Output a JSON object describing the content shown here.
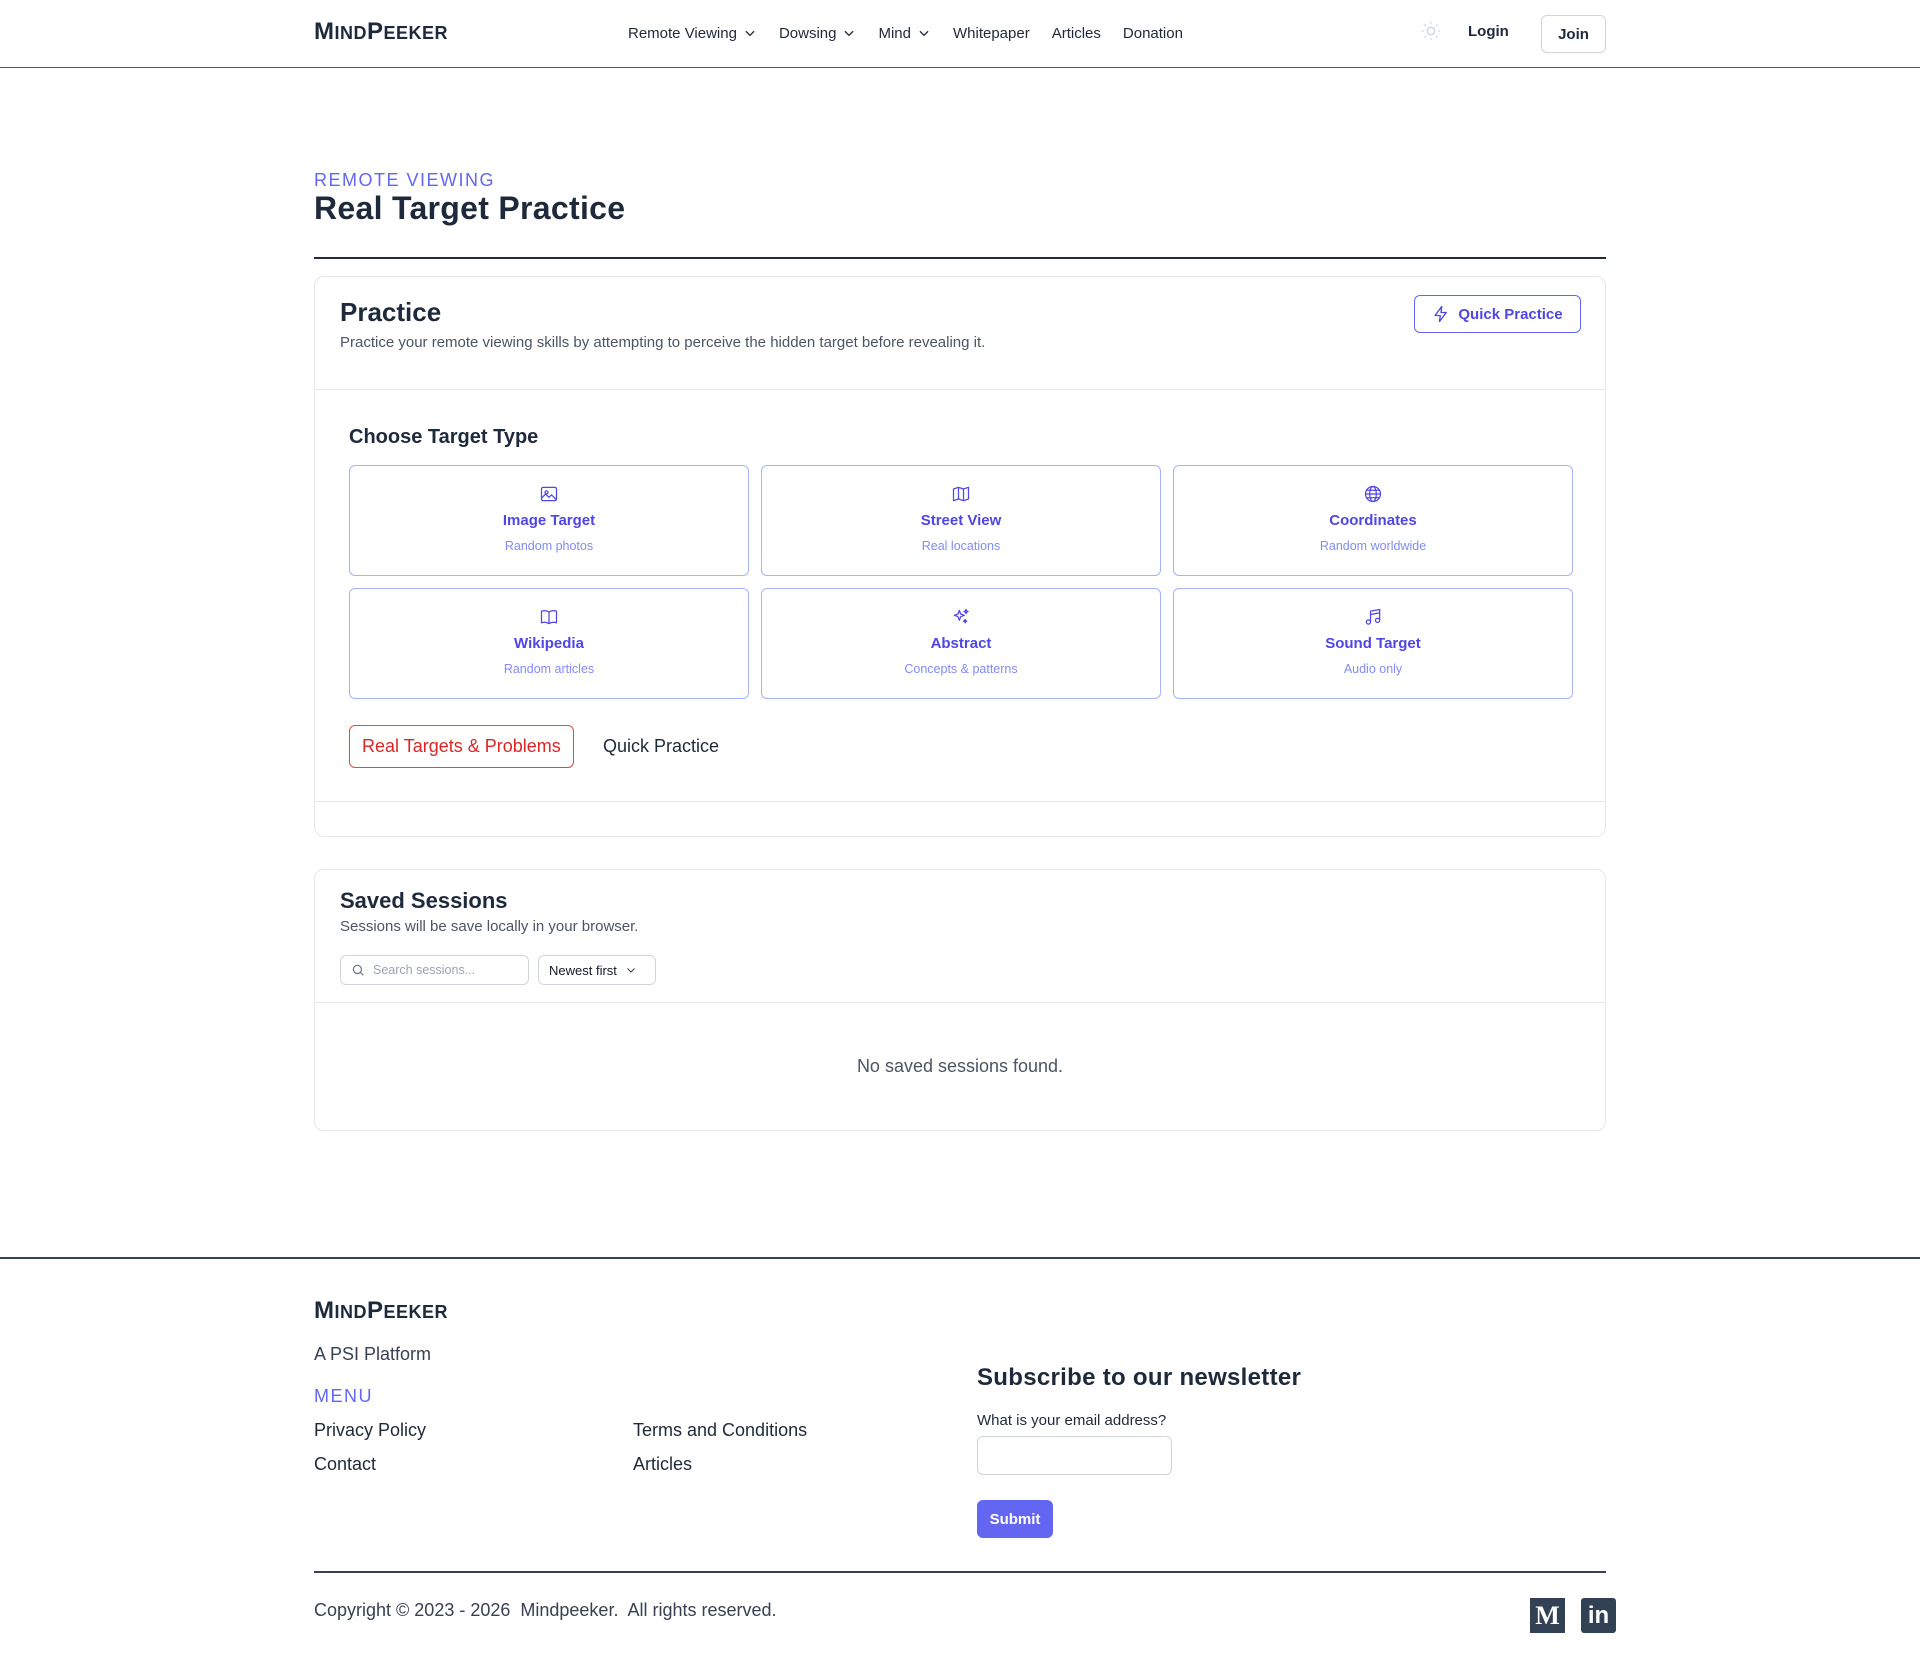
{
  "header": {
    "logo": {
      "initial1": "M",
      "rest1": "IND",
      "initial2": "P",
      "rest2": "EEKER"
    },
    "nav": [
      {
        "label": "Remote Viewing",
        "dropdown": true
      },
      {
        "label": "Dowsing",
        "dropdown": true
      },
      {
        "label": "Mind",
        "dropdown": true
      },
      {
        "label": "Whitepaper",
        "dropdown": false
      },
      {
        "label": "Articles",
        "dropdown": false
      },
      {
        "label": "Donation",
        "dropdown": false
      }
    ],
    "login": "Login",
    "join": "Join"
  },
  "page": {
    "eyebrow": "REMOTE VIEWING",
    "title": "Real Target Practice"
  },
  "practice": {
    "title": "Practice",
    "description": "Practice your remote viewing skills by attempting to perceive the hidden target before revealing it.",
    "quick_practice_button": "Quick Practice",
    "choose_title": "Choose Target Type",
    "target_types": [
      {
        "title": "Image Target",
        "subtitle": "Random photos",
        "icon": "image-icon"
      },
      {
        "title": "Street View",
        "subtitle": "Real locations",
        "icon": "map-icon"
      },
      {
        "title": "Coordinates",
        "subtitle": "Random worldwide",
        "icon": "globe-icon"
      },
      {
        "title": "Wikipedia",
        "subtitle": "Random articles",
        "icon": "book-icon"
      },
      {
        "title": "Abstract",
        "subtitle": "Concepts & patterns",
        "icon": "sparkles-icon"
      },
      {
        "title": "Sound Target",
        "subtitle": "Audio only",
        "icon": "music-icon"
      }
    ],
    "real_targets_button": "Real Targets & Problems",
    "quick_practice_link": "Quick Practice"
  },
  "saved": {
    "title": "Saved Sessions",
    "description": "Sessions will be save locally in your browser.",
    "search_placeholder": "Search sessions...",
    "sort_value": "Newest first",
    "empty": "No saved sessions found."
  },
  "footer": {
    "tagline": "A PSI Platform",
    "menu_heading": "MENU",
    "links": [
      "Privacy Policy",
      "Contact",
      "Terms and Conditions",
      "Articles"
    ],
    "newsletter_title": "Subscribe to our newsletter",
    "newsletter_label": "What is your email address?",
    "submit": "Submit",
    "copyright": "Copyright © 2023 - 2026  Mindpeeker.  All rights reserved.",
    "social": {
      "medium": "M",
      "linkedin": "in"
    }
  },
  "colors": {
    "accent": "#6366f1",
    "danger": "#ef4444",
    "text_dark": "#1e293b"
  }
}
